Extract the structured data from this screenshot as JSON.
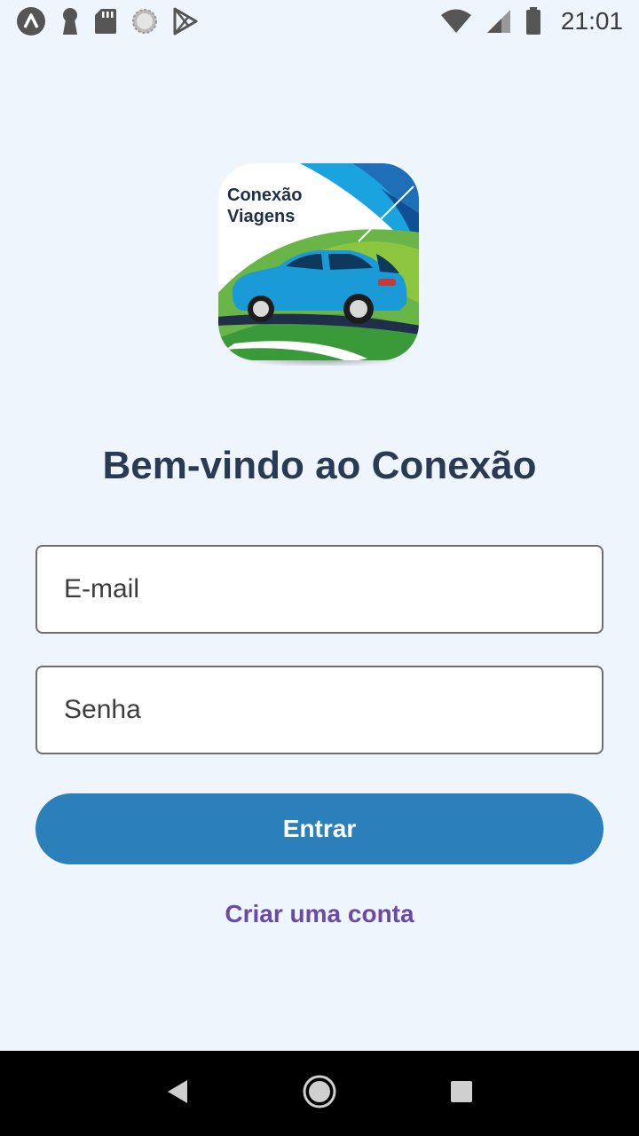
{
  "status_bar": {
    "time": "21:01",
    "left_icons": [
      "expo-icon",
      "keyhole-icon",
      "sd-card-icon",
      "loading-icon",
      "play-store-icon"
    ],
    "right_icons": [
      "wifi-icon",
      "signal-icon",
      "battery-icon"
    ]
  },
  "logo": {
    "line1": "Conexão",
    "line2": "Viagens"
  },
  "title": "Bem-vindo ao Conexão",
  "form": {
    "email_placeholder": "E-mail",
    "password_placeholder": "Senha",
    "login_label": "Entrar",
    "create_account_label": "Criar uma conta"
  },
  "colors": {
    "background": "#eef5fd",
    "primary": "#2b80bb",
    "link": "#6b4aa3",
    "title": "#2a3a52"
  },
  "nav_bar": {
    "buttons": [
      "back-icon",
      "home-icon",
      "recents-icon"
    ]
  }
}
